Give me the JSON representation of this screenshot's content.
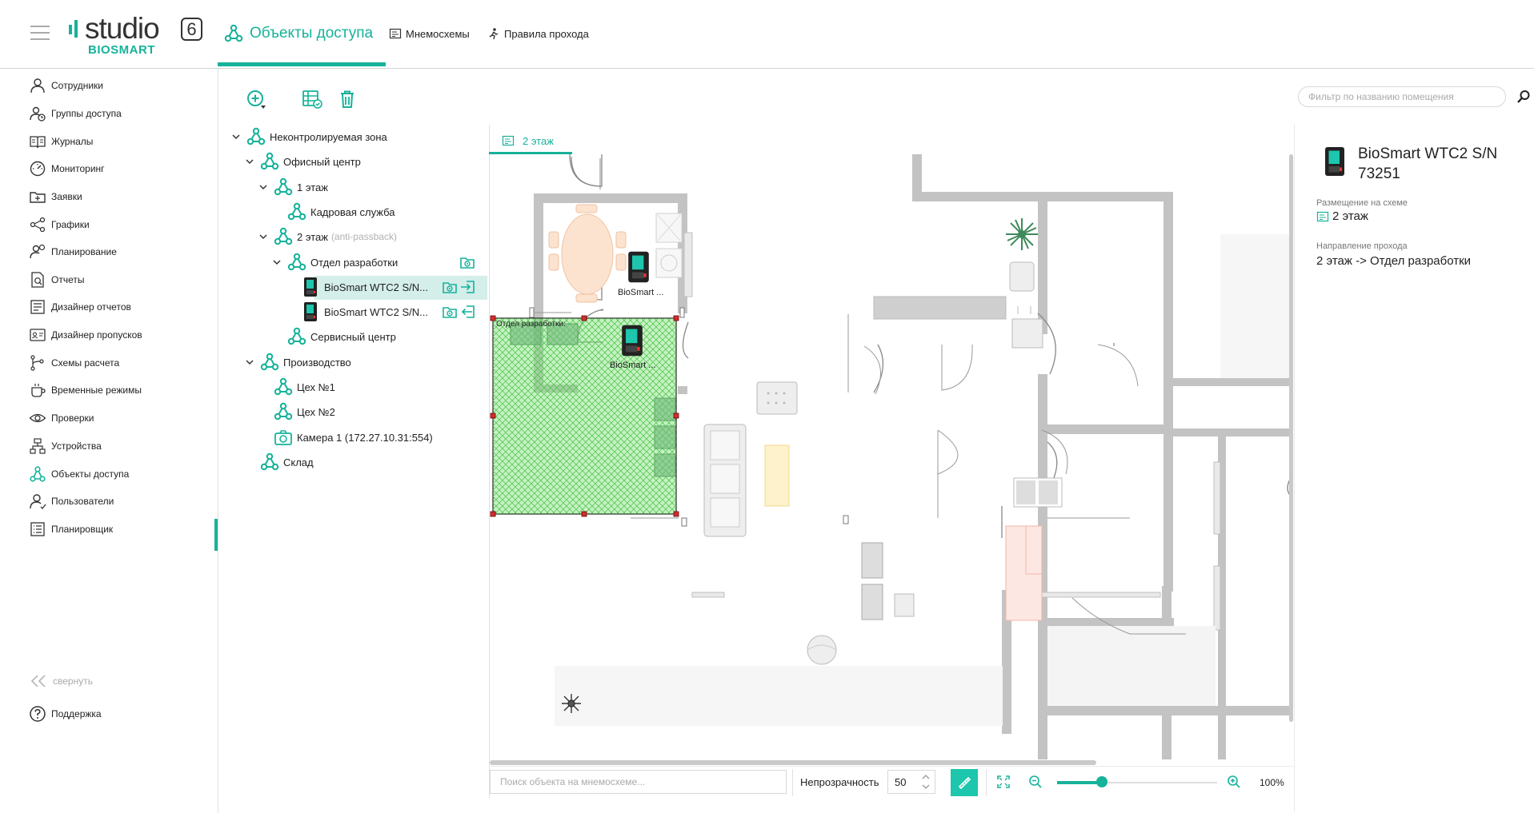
{
  "header": {
    "logo": {
      "studio": "studio",
      "version": "6",
      "brand": "BIOSMART"
    },
    "tabs": [
      {
        "label": "Объекты доступа",
        "icon": "access-objects-icon",
        "active": true
      },
      {
        "label": "Мнемосхемы",
        "icon": "mnemoscheme-icon",
        "active": false
      },
      {
        "label": "Правила прохода",
        "icon": "pass-rules-icon",
        "active": false
      }
    ]
  },
  "sidebar": {
    "items": [
      {
        "label": "Сотрудники",
        "icon": "person-icon"
      },
      {
        "label": "Группы доступа",
        "icon": "group-icon"
      },
      {
        "label": "Журналы",
        "icon": "journal-icon"
      },
      {
        "label": "Мониторинг",
        "icon": "monitoring-icon"
      },
      {
        "label": "Заявки",
        "icon": "request-icon"
      },
      {
        "label": "Графики",
        "icon": "schedule-icon"
      },
      {
        "label": "Планирование",
        "icon": "planning-icon"
      },
      {
        "label": "Отчеты",
        "icon": "report-icon"
      },
      {
        "label": "Дизайнер отчетов",
        "icon": "report-designer-icon"
      },
      {
        "label": "Дизайнер пропусков",
        "icon": "pass-designer-icon"
      },
      {
        "label": "Схемы расчета",
        "icon": "calc-scheme-icon"
      },
      {
        "label": "Временные режимы",
        "icon": "time-mode-icon"
      },
      {
        "label": "Проверки",
        "icon": "check-icon"
      },
      {
        "label": "Устройства",
        "icon": "devices-icon"
      },
      {
        "label": "Объекты доступа",
        "icon": "access-objects-icon",
        "active": true
      },
      {
        "label": "Пользователи",
        "icon": "users-icon"
      },
      {
        "label": "Планировщик",
        "icon": "scheduler-icon"
      }
    ],
    "collapse_label": "свернуть",
    "support_label": "Поддержка"
  },
  "toolbar": {
    "filter_placeholder": "Фильтр по названию помещения"
  },
  "tree": [
    {
      "label": "Неконтролируемая зона",
      "level": 0,
      "expanded": true,
      "icon": "zone-icon"
    },
    {
      "label": "Офисный центр",
      "level": 1,
      "expanded": true,
      "icon": "zone-icon"
    },
    {
      "label": "1 этаж",
      "level": 2,
      "expanded": true,
      "icon": "zone-icon"
    },
    {
      "label": "Кадровая служба",
      "level": 3,
      "icon": "zone-icon"
    },
    {
      "label": "2 этаж",
      "sub": "(anti-passback)",
      "level": 2,
      "expanded": true,
      "icon": "zone-icon"
    },
    {
      "label": "Отдел разработки",
      "level": 3,
      "expanded": true,
      "icon": "zone-icon",
      "actions": [
        "on-map-icon"
      ]
    },
    {
      "label": "BioSmart WTC2 S/N...",
      "level": 4,
      "icon": "terminal-icon",
      "selected": true,
      "actions": [
        "on-map-icon",
        "entry-icon"
      ]
    },
    {
      "label": "BioSmart WTC2 S/N...",
      "level": 4,
      "icon": "terminal-icon",
      "actions": [
        "on-map-icon",
        "exit-icon"
      ]
    },
    {
      "label": "Сервисный центр",
      "level": 3,
      "icon": "zone-icon"
    },
    {
      "label": "Производство",
      "level": 1,
      "expanded": true,
      "icon": "zone-icon"
    },
    {
      "label": "Цех №1",
      "level": 2,
      "icon": "zone-icon"
    },
    {
      "label": "Цех №2",
      "level": 2,
      "icon": "zone-icon"
    },
    {
      "label": "Камера 1 (172.27.10.31:554)",
      "level": 2,
      "icon": "camera-icon"
    },
    {
      "label": "Склад",
      "level": 1,
      "icon": "zone-icon"
    }
  ],
  "map": {
    "tab_label": "2 этаж",
    "zone_label": "Отдел разработки:",
    "device_labels": [
      "BioSmart ...",
      "BioSmart ..."
    ],
    "search_placeholder": "Поиск объекта на мнемосхеме...",
    "opacity_label": "Непрозрачность",
    "opacity_value": "50",
    "zoom_label": "100%",
    "zoom_level": 0.28
  },
  "details": {
    "title": "BioSmart WTC2 S/N 73251",
    "placement_label": "Размещение на схеме",
    "placement_value": "2 этаж",
    "direction_label": "Направление прохода",
    "direction_value": "2 этаж -> Отдел разработки"
  },
  "colors": {
    "accent": "#16b29a",
    "selection": "#d4eeea",
    "zone_fill": "#7fe07a"
  }
}
